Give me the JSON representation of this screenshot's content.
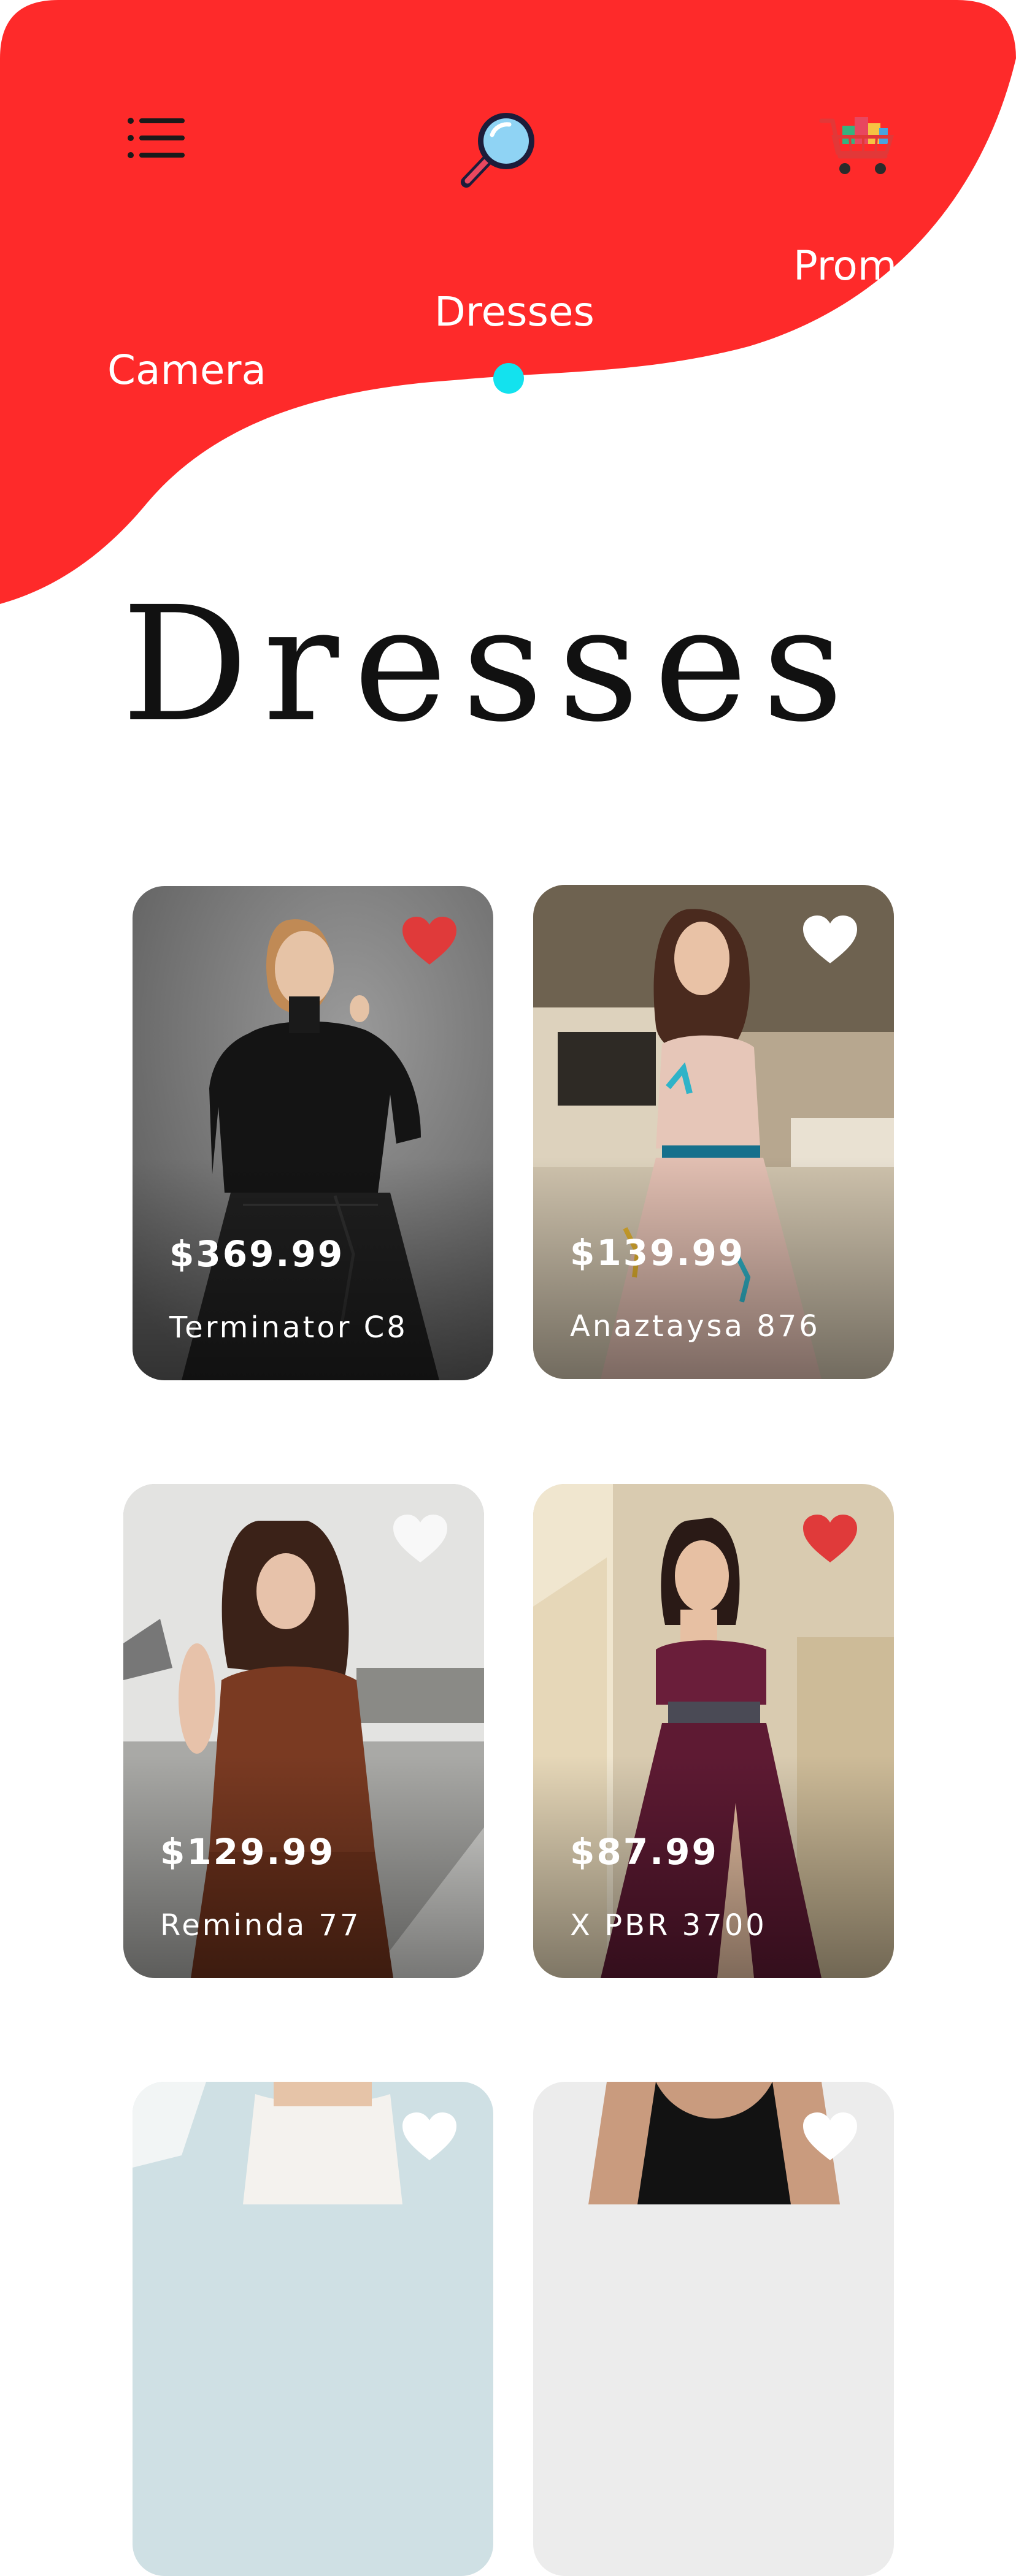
{
  "header": {
    "menu_icon": "menu-list-icon",
    "search_icon": "magnifier-icon",
    "cart_icon": "shopping-cart-icon",
    "accent_color": "#fe2a2a",
    "active_dot_color": "#13e2ee"
  },
  "categories": [
    {
      "label": "Camera"
    },
    {
      "label": "Dresses",
      "active": true
    },
    {
      "label": "Promo"
    }
  ],
  "page_title": "Dresses",
  "products": [
    {
      "price": "$369.99",
      "name": "Terminator C8",
      "favorite": true
    },
    {
      "price": "$139.99",
      "name": "Anaztaysa 876",
      "favorite": false
    },
    {
      "price": "$129.99",
      "name": "Reminda 77",
      "favorite": false
    },
    {
      "price": "$87.99",
      "name": "X PBR 3700",
      "favorite": true
    },
    {
      "price": "",
      "name": "",
      "favorite": false
    },
    {
      "price": "",
      "name": "",
      "favorite": false
    }
  ]
}
